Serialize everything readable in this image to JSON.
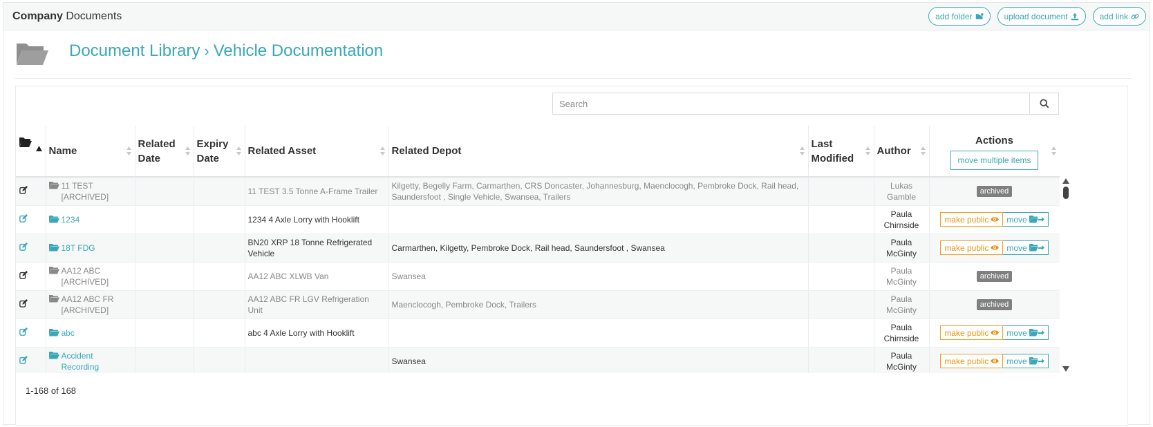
{
  "header": {
    "title_bold": "Company",
    "title_rest": " Documents",
    "add_folder_label": "add folder",
    "upload_document_label": "upload document",
    "add_link_label": "add link"
  },
  "breadcrumb": {
    "root": "Document Library",
    "separator": "›",
    "current": "Vehicle Documentation"
  },
  "search": {
    "placeholder": "Search"
  },
  "table": {
    "columns": {
      "name": "Name",
      "related_date": "Related Date",
      "expiry_date": "Expiry Date",
      "related_asset": "Related Asset",
      "related_depot": "Related Depot",
      "last_modified": "Last Modified",
      "author": "Author",
      "actions": "Actions"
    },
    "move_multiple_label": "move multiple items",
    "make_public_label": "make public",
    "move_label": "move",
    "archived_label": "archived",
    "rows": [
      {
        "name": "11 TEST",
        "name_suffix": "[ARCHIVED]",
        "asset": "11 TEST 3.5 Tonne A-Frame Trailer",
        "depot": "Kilgetty, Begelly Farm, Carmarthen, CRS Doncaster, Johannesburg, Maenclocogh, Pembroke Dock, Rail head, Saundersfoot , Single Vehicle, Swansea, Trailers",
        "author_first": "Lukas",
        "author_last": "Gamble"
      },
      {
        "name": "1234",
        "asset": "1234 4 Axle Lorry with Hooklift",
        "depot": "",
        "author_first": "Paula",
        "author_last": "Chirnside"
      },
      {
        "name": "18T FDG",
        "asset": "BN20 XRP 18 Tonne Refrigerated Vehicle",
        "depot": "Carmarthen, Kilgetty, Pembroke Dock, Rail head, Saundersfoot , Swansea",
        "author_first": "Paula",
        "author_last": "McGinty"
      },
      {
        "name": "AA12 ABC",
        "name_suffix": "[ARCHIVED]",
        "asset": "AA12 ABC XLWB Van",
        "depot": "Swansea",
        "author_first": "Paula",
        "author_last": "McGinty"
      },
      {
        "name": "AA12 ABC FR",
        "name_suffix": "[ARCHIVED]",
        "asset": "AA12 ABC FR LGV Refrigeration Unit",
        "depot": "Maenclocogh, Pembroke Dock, Trailers",
        "author_first": "Paula",
        "author_last": "McGinty"
      },
      {
        "name": "abc",
        "asset": "abc 4 Axle Lorry with Hooklift",
        "depot": "",
        "author_first": "Paula",
        "author_last": "Chirnside"
      },
      {
        "name": "Accident Recording",
        "asset": "",
        "depot": "Swansea",
        "author_first": "Paula",
        "author_last": "McGinty"
      }
    ]
  },
  "footer": {
    "range": "1-168",
    "of_word": "of",
    "total": "168"
  },
  "colors": {
    "accent": "#3aa7b8",
    "make_public": "#f0a020",
    "archived_badge": "#7f7f7f"
  }
}
